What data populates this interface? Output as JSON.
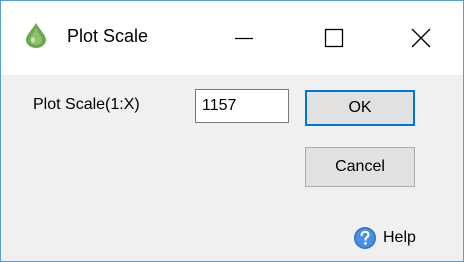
{
  "window": {
    "title": "Plot Scale",
    "icon": "green-droplet-icon",
    "controls": [
      "minimize-icon",
      "maximize-icon",
      "close-icon"
    ],
    "accent_color": "#5b9bd5"
  },
  "form": {
    "scale_label": "Plot Scale(1:X)",
    "scale_value": "1157"
  },
  "buttons": {
    "ok_label": "OK",
    "cancel_label": "Cancel",
    "ok_border_color": "#0078d7"
  },
  "footer": {
    "help_label": "Help",
    "help_icon": "question-circle-icon"
  }
}
